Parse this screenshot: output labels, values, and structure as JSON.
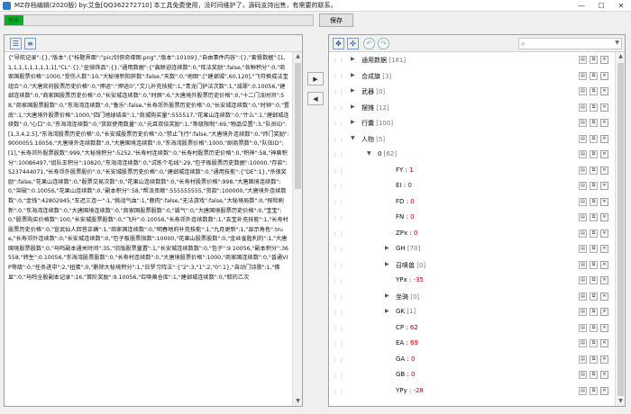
{
  "titlebar": {
    "title": "MZ存档编辑(2020版) by:艾鱼[QQ362272710] 本工具免费使用，没时间维护了，源码支持出售，有需要的联系。",
    "min": "—",
    "max": "☐",
    "close": "✕"
  },
  "progress": {
    "label": "完毕",
    "value": 1.0,
    "color": "#06b025"
  },
  "save_label": "保存",
  "left_toolbar": {
    "expand_icon": "expand-all-icon",
    "list_icon": "list-icon"
  },
  "json_text": "{\"导航记录\":{},\"版本\":{\"标题界面\":\"pic/剑侠奇缘图.png\",\"版本\":10109},\"自由事件内容\":{},\"套餐数据\":[1,1,1,1,1,1,1,1,1,1],\"CL\":{},\"坐骑饰品\":{},\"通用数据\":{\"轰联迎连续数\":0,\"阵法奖励\":false,\"各种积分\":0,\"商家国股票价格\":1000,\"受伤人数\":10,\"大秘境积阳获数\":false,\"天数\":0,\"地图\":[\"建邺城\",60,120],\"飞符换成法宝组合\":0,\"大唐官府股票历史价格\":0,\"押运\":\"押运0\",\"文儿补充技能\":1,\"青龙门护法次数\":1,\"减罪\":0.10056,\"建邺连续数\":0,\"商家国股票历史价格\":0,\"长安城连续数\":0,\"时辰\":6,\"大唐境外股票历史价格\":0,\"十二门派时间\":58,\"商家国股票股数\":0,\"东海湾连续数\":0,\"鲁乐\":false,\"长寿郊外股票历史价格\":0,\"长安城连续数\":0,\"时钟\":0,\"置底\":1,\"大唐境外股票价格\":1000,\"四门地球结束\":1,\"商城购买量\":555517,\"花果山连续数\":0,\"什么\":1,\"建邺城连续数\":0,\"心口\":0,\"东海湾连续数\":0,\"货款使用数量\":0,\"元旦双倍奖励\":1,\"等级限制\":69,\"物品位置\":3,\"队员ID\":[1,3,4,2,5],\"东海湾股票历史价格\":0,\"长安城股票历史价格\":0,\"禁止飞行\":false,\"大唐境外连续数\":0,\"师门奖励\":9000055.10056,\"大唐境外连续数数\":0,\"大唐国境连续数\":0,\"东海湾股票价格\":1000,\"剧商票数\":0,\"队伍ID\":[1],\"长寿郊外股票股数\":999,\"大秘境积分\":5252,\"长寿村连续数\":0,\"长寿村股票历史价格\":0,\"积神\":58,\"神兽积分\":10086497,\"组队王积分\":10820,\"东海湾连续数\":0,\"试炼个毛线\":29,\"包子板股票历史数据\":10000,\"存款\":5237444071,\"长寿郊外股票股价\":0,\"长安城股票历史价格\":0,\"建邺城连续数\":0,\"通用技能\":{\"DE\":1},\"杀很奖励\":false,\"花果山连续数\":0,\"股票交易次数\":0,\"花果山连续数数\":0,\"长寿村股票价格\":998,\"大唐国境连续数\":0,\"突破\":0.10056,\"花果山连续数\":0,\"副本积分\":58,\"帮派贡献\":555555555,\"货款\":100000,\"大唐境外连续数数\":0,\"金钱\":42802945,\"车迟三连一\":1,\"挑战气血\":1,\"鹿肉\":false,\"无法游戏\":false,\"大秘境局数\":0,\"探险刷新\":0,\"东海湾连续数\":0,\"大唐国境连续数\":0,\"商家国股票股数\":0,\"毁气\":0,\"大唐国境股票历史价格\":0,\"宝宝\":0,\"股票购买价格数\":100,\"长安城股票股数\":0,\"飞升\":0.10056,\"长寿郊外连续数数\":1,\"五宝补充技能\":1,\"长寿村股票历史价格\":0,\"宣武仙人回答正确\":1,\"商家国连续数\":0,\"明春地府补充技能\":1,\"九月更新\":1,\"显示角色\":true,\"长寿郊外连续数\":0,\"长安城连续数\":0,\"包子板股票指数\":10000,\"花果山股票股数\":0,\"金丝雀胜利的\":1,\"大唐国境股票股数\":0,\"马鸣副本通关时间\":35,\"旧版股票量置\":1,\"长安城连续数数\":0,\"包子\":9.10056,\"副本积分\":36558,\"转生\":0.10056,\"东海湾股票股数\":0,\"长寿村连续数\":0,\"大唐境股票价格\":1000,\"商家国连续数\":0,\"普通VIP等级\":0,\"任务进中\":2,\"扭蛋\":0,\"删除大秘境积分\":1,\"日罗习阵法\":{\"2\":3,\"1\":2,\"0\":1},\"自动门诗歌\":1,\"佛显\":0,\"马鸣全股副本记录\":16,\"首阶奖励\":9.10056,\"召唤兽仓库\":1,\"建邺城连续数\":0,\"取的乙次",
  "middle_buttons": {
    "to_right": "▶",
    "to_left": "◀"
  },
  "right_toolbar": {
    "expand_icon": "expand-icon",
    "collapse_icon": "collapse-icon",
    "undo_icon": "undo-icon",
    "redo_icon": "redo-icon",
    "search_placeholder": ""
  },
  "tree": [
    {
      "expander": "▶",
      "key": "通用数据",
      "count": "[181]"
    },
    {
      "expander": "▶",
      "key": "合成旗",
      "count": "[3]"
    },
    {
      "expander": "▶",
      "key": "武器",
      "count": "[0]"
    },
    {
      "expander": "▶",
      "key": "摆摊",
      "count": "[12]"
    },
    {
      "expander": "▶",
      "key": "行囊",
      "count": "[100]"
    },
    {
      "expander": "▼",
      "key": "人物",
      "count": "[5]"
    },
    {
      "expander": "▼",
      "key": "0",
      "count": "[62]"
    },
    {
      "expander": "",
      "key": "FY",
      "value": "1"
    },
    {
      "expander": "",
      "key": "EI",
      "value": "0"
    },
    {
      "expander": "",
      "key": "FD",
      "value": "0"
    },
    {
      "expander": "",
      "key": "FN",
      "value": "0"
    },
    {
      "expander": "",
      "key": "ZPx",
      "value": "0"
    },
    {
      "expander": "▶",
      "key": "GH",
      "count": "[70]"
    },
    {
      "expander": "▶",
      "key": "召唤兽",
      "count": "[0]"
    },
    {
      "expander": "",
      "key": "YPx",
      "value": "-35"
    },
    {
      "expander": "▶",
      "key": "坐骑",
      "count": "[0]"
    },
    {
      "expander": "▶",
      "key": "GK",
      "count": "[1]"
    },
    {
      "expander": "",
      "key": "CP",
      "value": "62"
    },
    {
      "expander": "",
      "key": "EA",
      "value": "69"
    },
    {
      "expander": "",
      "key": "GA",
      "value": "0"
    },
    {
      "expander": "",
      "key": "GB",
      "value": "0"
    },
    {
      "expander": "",
      "key": "YPy",
      "value": "-28"
    }
  ]
}
